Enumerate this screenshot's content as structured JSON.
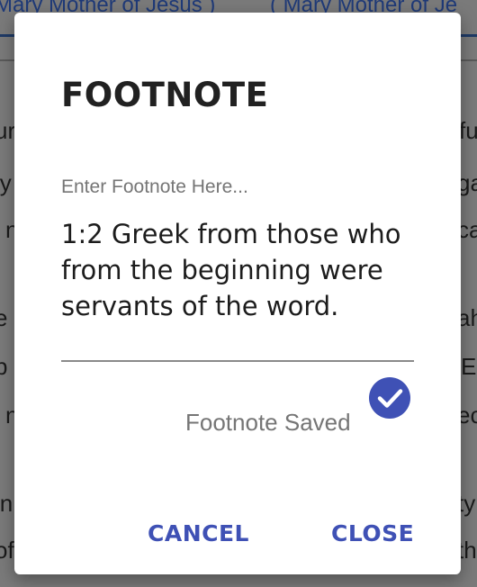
{
  "background": {
    "tabs": [
      "Mary Mother of Jesus )",
      "( Mary Mother of Je"
    ],
    "fragments": [
      "ur",
      "fu",
      "ly",
      "ga",
      "n",
      "ca",
      "e",
      "ah",
      "p",
      "E",
      "n",
      "ec",
      "in",
      "ty",
      "of",
      "th"
    ]
  },
  "dialog": {
    "title": "FOOTNOTE",
    "input_label": "Enter Footnote Here...",
    "input_value": "1:2 Greek from those who from the beginning were servants of the word.",
    "saved_status": "Footnote Saved",
    "saved_icon": "check-circle-icon",
    "cancel_label": "CANCEL",
    "close_label": "CLOSE"
  },
  "colors": {
    "accent": "#3f51b5",
    "scrim": "#7a7a7a",
    "dialog_bg": "#ffffff"
  }
}
